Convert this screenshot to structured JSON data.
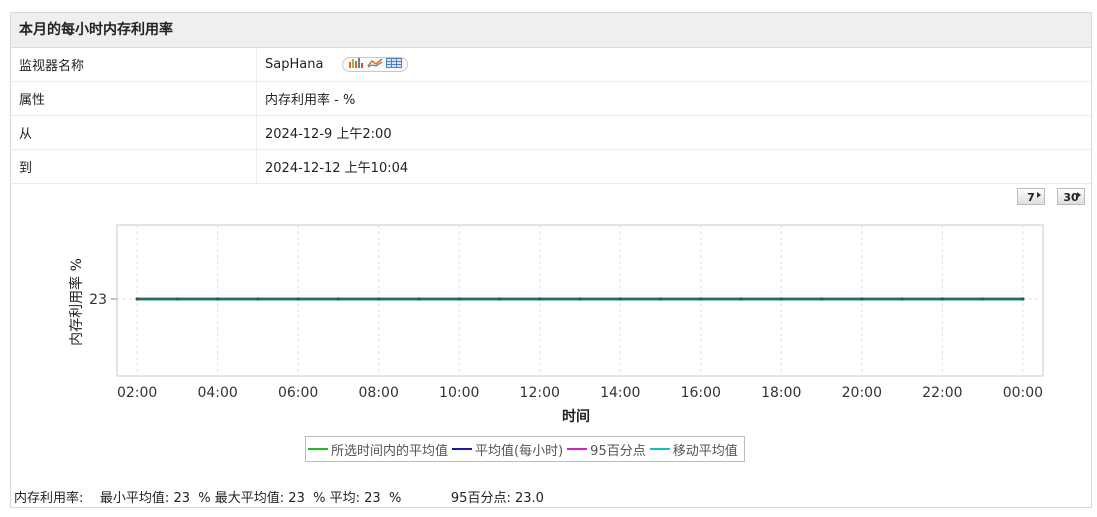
{
  "panel": {
    "title": "本月的每小时内存利用率"
  },
  "info": [
    {
      "key": "监视器名称",
      "value": "SapHana"
    },
    {
      "key": "属性",
      "value": "内存利用率 - %"
    },
    {
      "key": "从",
      "value": "2024-12-9 上午2:00"
    },
    {
      "key": "到",
      "value": "2024-12-12 上午10:04"
    }
  ],
  "report_icons": [
    "bar-chart-icon",
    "line-chart-icon",
    "table-icon"
  ],
  "periods": [
    "7",
    "30"
  ],
  "chart_data": {
    "type": "line",
    "title": "",
    "xlabel": "时间",
    "ylabel": "内存利用率 %",
    "y_ticks": [
      "23"
    ],
    "x_ticks": [
      "02:00",
      "04:00",
      "06:00",
      "08:00",
      "10:00",
      "12:00",
      "14:00",
      "16:00",
      "18:00",
      "20:00",
      "22:00",
      "00:00"
    ],
    "grid": true,
    "series": [
      {
        "name": "所选时间内的平均值",
        "color": "#22bb22",
        "x_hours": [
          2,
          24
        ],
        "values": [
          23,
          23
        ]
      },
      {
        "name": "平均值(每小时)",
        "color": "#1a1aa8",
        "x_hours": [
          2,
          3,
          4,
          5,
          6,
          7,
          8,
          9,
          10,
          11,
          12,
          13,
          14,
          15,
          16,
          17,
          18,
          19,
          20,
          21,
          22,
          23,
          24
        ],
        "values": [
          23,
          23,
          23,
          23,
          23,
          23,
          23,
          23,
          23,
          23,
          23,
          23,
          23,
          23,
          23,
          23,
          23,
          23,
          23,
          23,
          23,
          23,
          23
        ]
      },
      {
        "name": "95百分点",
        "color": "#cc22cc",
        "x_hours": [
          2,
          24
        ],
        "values": [
          23,
          23
        ]
      },
      {
        "name": "移动平均值",
        "color": "#22b8b8",
        "x_hours": [
          2,
          24
        ],
        "values": [
          23,
          23
        ]
      }
    ]
  },
  "summary": {
    "label": "内存利用率:",
    "min_label": "最小平均值:",
    "min_value": "23",
    "unit": "%",
    "max_label": "最大平均值:",
    "max_value": "23",
    "avg_label": "平均:",
    "avg_value": "23",
    "p95_label": "95百分点:",
    "p95_value": "23.0"
  }
}
